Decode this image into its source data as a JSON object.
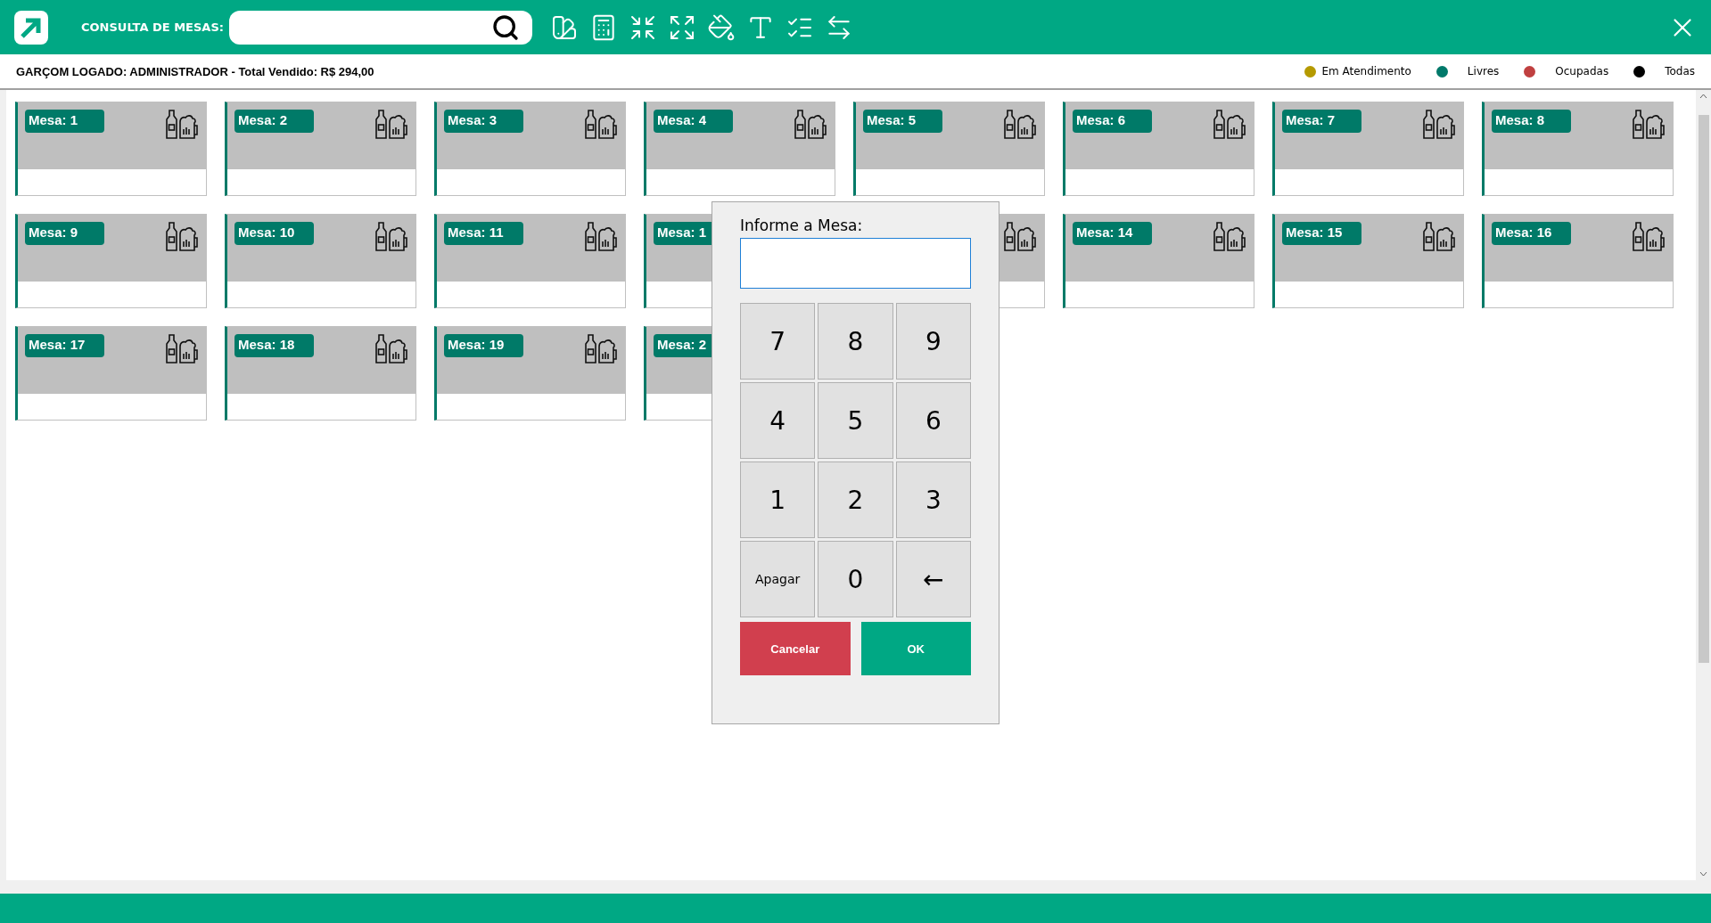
{
  "header": {
    "title": "CONSULTA DE MESAS:"
  },
  "status": {
    "text": "GARÇOM LOGADO: ADMINISTRADOR - Total Vendido: R$ 294,00"
  },
  "legend": [
    {
      "label": "Em Atendimento",
      "color": "#b59a00"
    },
    {
      "label": "Livres",
      "color": "#00796a"
    },
    {
      "label": "Ocupadas",
      "color": "#c04040"
    },
    {
      "label": "Todas",
      "color": "#000000"
    }
  ],
  "tables": [
    {
      "kind": "labeled",
      "label": "Mesa: 1"
    },
    {
      "kind": "labeled",
      "label": "Mesa: 2"
    },
    {
      "kind": "labeled",
      "label": "Mesa: 3"
    },
    {
      "kind": "labeled",
      "label": "Mesa: 4"
    },
    {
      "kind": "labeled",
      "label": "Mesa: 5"
    },
    {
      "kind": "labeled",
      "label": "Mesa: 6"
    },
    {
      "kind": "labeled",
      "label": "Mesa: 7"
    },
    {
      "kind": "labeled",
      "label": "Mesa: 8"
    },
    {
      "kind": "labeled",
      "label": "Mesa: 9"
    },
    {
      "kind": "labeled",
      "label": "Mesa: 10"
    },
    {
      "kind": "labeled",
      "label": "Mesa: 11"
    },
    {
      "kind": "labeled",
      "label": "Mesa: 1"
    },
    {
      "kind": "covered"
    },
    {
      "kind": "labeled",
      "label": "Mesa: 14"
    },
    {
      "kind": "labeled",
      "label": "Mesa: 15"
    },
    {
      "kind": "labeled",
      "label": "Mesa: 16"
    },
    {
      "kind": "labeled",
      "label": "Mesa: 17"
    },
    {
      "kind": "labeled",
      "label": "Mesa: 18"
    },
    {
      "kind": "labeled",
      "label": "Mesa: 19"
    },
    {
      "kind": "labeled",
      "label": "Mesa: 2"
    }
  ],
  "dialog": {
    "title": "Informe a Mesa:",
    "keys": [
      {
        "label": "7",
        "kind": "digit"
      },
      {
        "label": "8",
        "kind": "digit"
      },
      {
        "label": "9",
        "kind": "digit"
      },
      {
        "label": "4",
        "kind": "digit"
      },
      {
        "label": "5",
        "kind": "digit"
      },
      {
        "label": "6",
        "kind": "digit"
      },
      {
        "label": "1",
        "kind": "digit"
      },
      {
        "label": "2",
        "kind": "digit"
      },
      {
        "label": "3",
        "kind": "digit"
      },
      {
        "label": "Apagar",
        "kind": "word"
      },
      {
        "label": "0",
        "kind": "digit"
      },
      {
        "label": "←",
        "kind": "digit"
      }
    ],
    "buttons": [
      {
        "label": "Cancelar",
        "kind": "cancel"
      },
      {
        "label": "OK",
        "kind": "confirm"
      }
    ]
  }
}
